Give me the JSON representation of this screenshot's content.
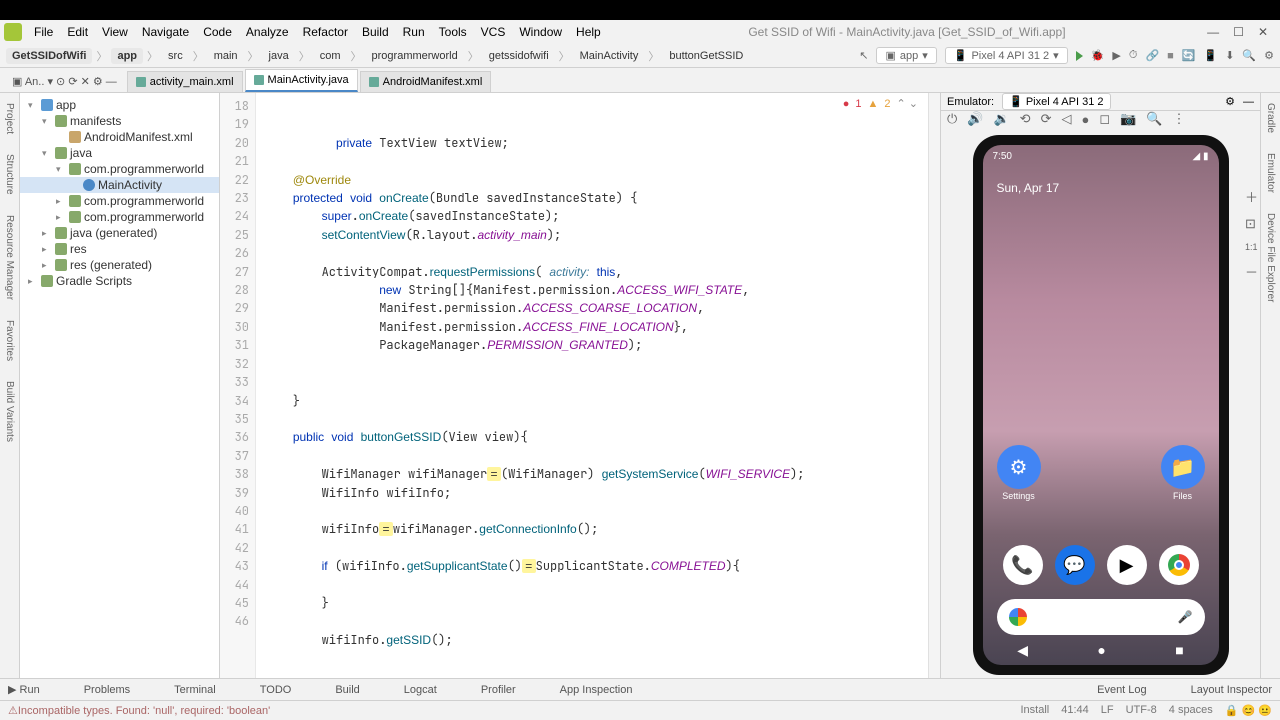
{
  "window": {
    "title": "Get SSID of Wifi - MainActivity.java [Get_SSID_of_Wifi.app]"
  },
  "menu": [
    "File",
    "Edit",
    "View",
    "Navigate",
    "Code",
    "Analyze",
    "Refactor",
    "Build",
    "Run",
    "Tools",
    "VCS",
    "Window",
    "Help"
  ],
  "breadcrumbs": [
    "GetSSIDofWifi",
    "app",
    "src",
    "main",
    "java",
    "com",
    "programmerworld",
    "getssidofwifi",
    "MainActivity",
    "buttonGetSSID"
  ],
  "configSelector": {
    "module": "app",
    "device": "Pixel 4 API 31 2"
  },
  "tabs": [
    {
      "label": "activity_main.xml",
      "active": false
    },
    {
      "label": "MainActivity.java",
      "active": true
    },
    {
      "label": "AndroidManifest.xml",
      "active": false
    }
  ],
  "projectTree": {
    "root": "app",
    "nodes": [
      {
        "indent": 0,
        "arrow": "▾",
        "icon": "mod",
        "label": "app"
      },
      {
        "indent": 1,
        "arrow": "▾",
        "icon": "fold",
        "label": "manifests"
      },
      {
        "indent": 2,
        "arrow": "",
        "icon": "file",
        "label": "AndroidManifest.xml"
      },
      {
        "indent": 1,
        "arrow": "▾",
        "icon": "fold",
        "label": "java"
      },
      {
        "indent": 2,
        "arrow": "▾",
        "icon": "fold",
        "label": "com.programmerworld"
      },
      {
        "indent": 3,
        "arrow": "",
        "icon": "cls",
        "label": "MainActivity",
        "sel": true
      },
      {
        "indent": 2,
        "arrow": "▸",
        "icon": "fold",
        "label": "com.programmerworld"
      },
      {
        "indent": 2,
        "arrow": "▸",
        "icon": "fold",
        "label": "com.programmerworld"
      },
      {
        "indent": 1,
        "arrow": "▸",
        "icon": "fold",
        "label": "java (generated)"
      },
      {
        "indent": 1,
        "arrow": "▸",
        "icon": "fold",
        "label": "res"
      },
      {
        "indent": 1,
        "arrow": "▸",
        "icon": "fold",
        "label": "res (generated)"
      },
      {
        "indent": 0,
        "arrow": "▸",
        "icon": "fold",
        "label": "Gradle Scripts"
      }
    ]
  },
  "leftTools": [
    "Project",
    "Structure",
    "Resource Manager",
    "Favorites",
    "Build Variants"
  ],
  "rightTools": [
    "Gradle",
    "Emulator",
    "Device File Explorer"
  ],
  "editor": {
    "firstLine": 18,
    "errors": "1",
    "warnings": "2",
    "lines": [
      "    private TextView textView;",
      "",
      "    @Override",
      "    protected void onCreate(Bundle savedInstanceState) {",
      "        super.onCreate(savedInstanceState);",
      "        setContentView(R.layout.activity_main);",
      "",
      "        ActivityCompat.requestPermissions( activity: this,",
      "                new String[]{Manifest.permission.ACCESS_WIFI_STATE,",
      "                Manifest.permission.ACCESS_COARSE_LOCATION,",
      "                Manifest.permission.ACCESS_FINE_LOCATION},",
      "                PackageManager.PERMISSION_GRANTED);",
      "",
      "",
      "    }",
      "",
      "    public void buttonGetSSID(View view){",
      "",
      "        WifiManager wifiManager = (WifiManager) getSystemService(WIFI_SERVICE);",
      "        WifiInfo wifiInfo;",
      "",
      "        wifiInfo = wifiManager.getConnectionInfo();",
      "",
      "        if (wifiInfo.getSupplicantState() = SupplicantState.COMPLETED){",
      "",
      "        }",
      "",
      "        wifiInfo.getSSID();",
      ""
    ]
  },
  "emulator": {
    "title": "Emulator:",
    "device": "Pixel 4 API 31 2",
    "clock": "7:50",
    "date": "Sun, Apr 17",
    "apps": {
      "settings": "Settings",
      "files": "Files"
    }
  },
  "bottomTools": [
    "Run",
    "Problems",
    "Terminal",
    "TODO",
    "Build",
    "Logcat",
    "Profiler",
    "App Inspection"
  ],
  "bottomRight": [
    "Event Log",
    "Layout Inspector"
  ],
  "status": {
    "msg": "Incompatible types. Found: 'null', required: 'boolean'",
    "install": "Install",
    "pos": "41:44",
    "sep": "LF",
    "enc": "UTF-8",
    "indent": "4 spaces"
  }
}
